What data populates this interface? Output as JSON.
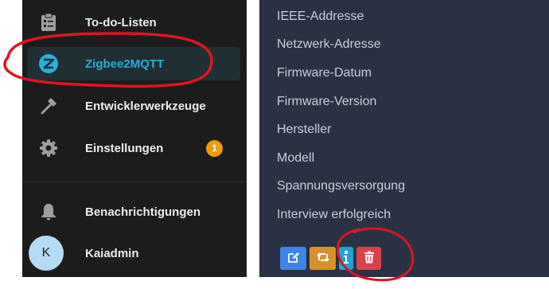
{
  "sidebar": {
    "items": [
      {
        "label": "To-do-Listen",
        "icon": "clipboard-list-icon"
      },
      {
        "label": "Zigbee2MQTT",
        "icon": "zigbee-icon",
        "active": true
      },
      {
        "label": "Entwicklerwerkzeuge",
        "icon": "hammer-icon"
      },
      {
        "label": "Einstellungen",
        "icon": "gear-icon",
        "badge": "1"
      }
    ],
    "notifications": {
      "label": "Benachrichtigungen",
      "icon": "bell-icon"
    },
    "user": {
      "label": "Kaiadmin",
      "avatar_initial": "K"
    }
  },
  "main": {
    "attributes": [
      "IEEE-Addresse",
      "Netzwerk-Adresse",
      "Firmware-Datum",
      "Firmware-Version",
      "Hersteller",
      "Modell",
      "Spannungsversorgung",
      "Interview erfolgreich"
    ],
    "buttons": [
      {
        "name": "edit-button",
        "icon": "edit-icon",
        "color": "#3b86e8"
      },
      {
        "name": "reconfigure-button",
        "icon": "retweet-icon",
        "color": "#d8902c"
      },
      {
        "name": "info-button",
        "icon": "info-icon",
        "color": "#1fa3d4"
      },
      {
        "name": "delete-button",
        "icon": "trash-icon",
        "color": "#d9424b"
      }
    ]
  },
  "colors": {
    "sidebar_bg": "#1c1c1c",
    "main_bg": "#2b3144",
    "accent": "#29aee0",
    "badge": "#f29a0e",
    "annotation": "#e0141e"
  }
}
